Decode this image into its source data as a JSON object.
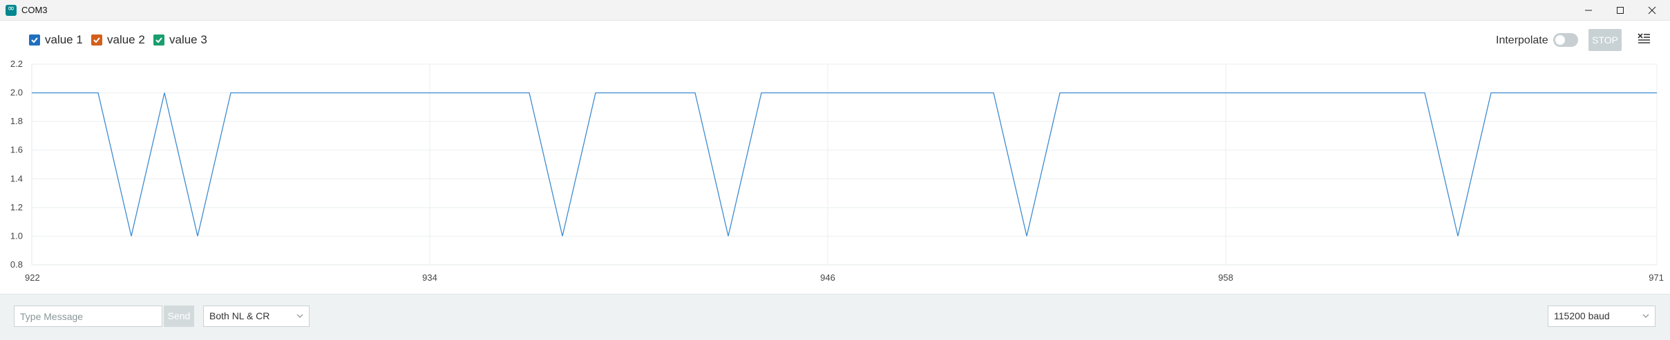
{
  "window": {
    "title": "COM3"
  },
  "legend": [
    {
      "label": "value 1",
      "color": "#1f6fbf",
      "checked": true
    },
    {
      "label": "value 2",
      "color": "#d35f1b",
      "checked": true
    },
    {
      "label": "value 3",
      "color": "#1a9e6e",
      "checked": true
    }
  ],
  "toolbar": {
    "interpolate_label": "Interpolate",
    "interpolate_on": false,
    "stop_label": "STOP"
  },
  "chart_data": {
    "type": "line",
    "xlim": [
      922,
      971
    ],
    "ylim": [
      0.8,
      2.2
    ],
    "x_ticks": [
      "922",
      "934",
      "946",
      "958",
      "971"
    ],
    "y_ticks": [
      "2.2",
      "2.0",
      "1.8",
      "1.6",
      "1.4",
      "1.2",
      "1.0",
      "0.8"
    ],
    "grid": true,
    "series": [
      {
        "name": "value 1",
        "color": "#3d8bd0",
        "x": [
          922,
          924,
          925,
          926,
          927,
          928,
          937,
          938,
          939,
          942,
          943,
          944,
          951,
          952,
          953,
          964,
          965,
          966,
          971
        ],
        "y": [
          2.0,
          2.0,
          1.0,
          2.0,
          1.0,
          2.0,
          2.0,
          1.0,
          2.0,
          2.0,
          1.0,
          2.0,
          2.0,
          1.0,
          2.0,
          2.0,
          1.0,
          2.0,
          2.0
        ]
      }
    ]
  },
  "bottom": {
    "message_placeholder": "Type Message",
    "send_label": "Send",
    "line_ending": "Both NL & CR",
    "baud": "115200 baud"
  }
}
